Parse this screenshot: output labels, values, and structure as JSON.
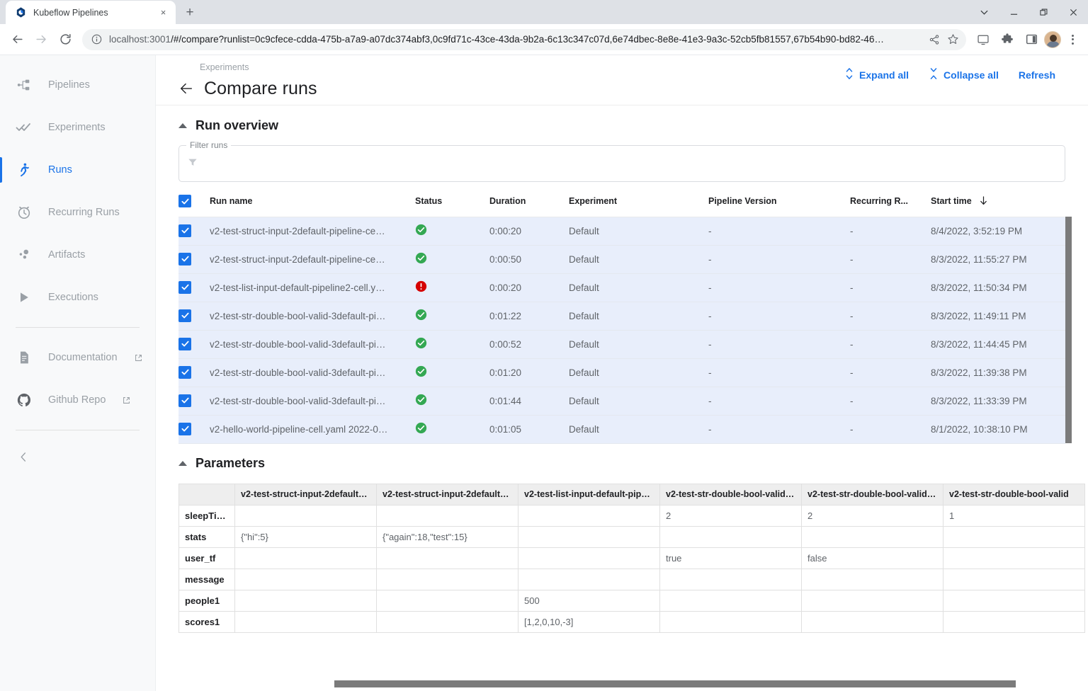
{
  "browser": {
    "tab": {
      "title": "Kubeflow Pipelines",
      "favicon": "kubeflow-logo-icon",
      "close": "×"
    },
    "new_tab_label": "+",
    "window_controls": {
      "tab_search": "tab-search-icon",
      "minimize": "minimize-icon",
      "maximize": "maximize-icon",
      "close": "close-icon"
    },
    "nav": {
      "back": "back-icon",
      "forward": "forward-icon",
      "reload": "reload-icon"
    },
    "omnibox": {
      "site_info": "info-icon",
      "scheme": "localhost:3001",
      "url_rest": "/#/compare?runlist=0c9cfece-cdda-475b-a7a9-a07dc374abf3,0c9fd71c-43ce-43da-9b2a-6c13c347c07d,6e74dbec-8e8e-41e3-9a3c-52cb5fb81557,67b54b90-bd82-46…",
      "share": "share-icon",
      "bookmark": "star-icon"
    },
    "actions": {
      "cast": "cast-icon",
      "extensions": "puzzle-icon",
      "side_panel": "side-panel-icon",
      "profile": "avatar",
      "menu": "kebab-menu-icon"
    }
  },
  "sidebar": {
    "items": [
      {
        "label": "Pipelines",
        "icon": "pipelines-icon",
        "active": false,
        "external": false
      },
      {
        "label": "Experiments",
        "icon": "experiments-icon",
        "active": false,
        "external": false
      },
      {
        "label": "Runs",
        "icon": "runs-icon",
        "active": true,
        "external": false
      },
      {
        "label": "Recurring Runs",
        "icon": "clock-icon",
        "active": false,
        "external": false
      },
      {
        "label": "Artifacts",
        "icon": "artifacts-icon",
        "active": false,
        "external": false
      },
      {
        "label": "Executions",
        "icon": "play-icon",
        "active": false,
        "external": false
      }
    ],
    "links": [
      {
        "label": "Documentation",
        "icon": "document-icon",
        "external": true
      },
      {
        "label": "Github Repo",
        "icon": "github-icon",
        "external": true
      }
    ],
    "collapse": "chevron-left-icon",
    "accent": "#1a73e8"
  },
  "header": {
    "breadcrumb": "Experiments",
    "title": "Compare runs",
    "back": "back-arrow-icon",
    "actions": [
      {
        "label": "Expand all",
        "icon": "expand-all-icon"
      },
      {
        "label": "Collapse all",
        "icon": "collapse-all-icon"
      },
      {
        "label": "Refresh",
        "icon": ""
      }
    ]
  },
  "run_overview": {
    "section_title": "Run overview",
    "filter": {
      "legend": "Filter runs",
      "value": "",
      "placeholder": "",
      "icon": "filter-icon"
    },
    "columns": [
      "Run name",
      "Status",
      "Duration",
      "Experiment",
      "Pipeline Version",
      "Recurring R...",
      "Start time"
    ],
    "sort_column": "Start time",
    "sort_direction": "desc",
    "select_all_checked": true,
    "rows": [
      {
        "checked": true,
        "name": "v2-test-struct-input-2default-pipeline-ce…",
        "status": "succeeded",
        "duration": "0:00:20",
        "experiment": "Default",
        "pipeline_version": "-",
        "recurring_run": "-",
        "start_time": "8/4/2022, 3:52:19 PM"
      },
      {
        "checked": true,
        "name": "v2-test-struct-input-2default-pipeline-ce…",
        "status": "succeeded",
        "duration": "0:00:50",
        "experiment": "Default",
        "pipeline_version": "-",
        "recurring_run": "-",
        "start_time": "8/3/2022, 11:55:27 PM"
      },
      {
        "checked": true,
        "name": "v2-test-list-input-default-pipeline2-cell.y…",
        "status": "failed",
        "duration": "0:00:20",
        "experiment": "Default",
        "pipeline_version": "-",
        "recurring_run": "-",
        "start_time": "8/3/2022, 11:50:34 PM"
      },
      {
        "checked": true,
        "name": "v2-test-str-double-bool-valid-3default-pi…",
        "status": "succeeded",
        "duration": "0:01:22",
        "experiment": "Default",
        "pipeline_version": "-",
        "recurring_run": "-",
        "start_time": "8/3/2022, 11:49:11 PM"
      },
      {
        "checked": true,
        "name": "v2-test-str-double-bool-valid-3default-pi…",
        "status": "succeeded",
        "duration": "0:00:52",
        "experiment": "Default",
        "pipeline_version": "-",
        "recurring_run": "-",
        "start_time": "8/3/2022, 11:44:45 PM"
      },
      {
        "checked": true,
        "name": "v2-test-str-double-bool-valid-3default-pi…",
        "status": "succeeded",
        "duration": "0:01:20",
        "experiment": "Default",
        "pipeline_version": "-",
        "recurring_run": "-",
        "start_time": "8/3/2022, 11:39:38 PM"
      },
      {
        "checked": true,
        "name": "v2-test-str-double-bool-valid-3default-pi…",
        "status": "succeeded",
        "duration": "0:01:44",
        "experiment": "Default",
        "pipeline_version": "-",
        "recurring_run": "-",
        "start_time": "8/3/2022, 11:33:39 PM"
      },
      {
        "checked": true,
        "name": "v2-hello-world-pipeline-cell.yaml 2022-0…",
        "status": "succeeded",
        "duration": "0:01:05",
        "experiment": "Default",
        "pipeline_version": "-",
        "recurring_run": "-",
        "start_time": "8/1/2022, 10:38:10 PM"
      }
    ],
    "status_colors": {
      "succeeded": "#34a853",
      "failed": "#d50000"
    }
  },
  "parameters": {
    "section_title": "Parameters",
    "corner_label": "",
    "columns": [
      "v2-test-struct-input-2default…",
      "v2-test-struct-input-2default…",
      "v2-test-list-input-default-pip…",
      "v2-test-str-double-bool-valid…",
      "v2-test-str-double-bool-valid…",
      "v2-test-str-double-bool-valid"
    ],
    "rows": [
      {
        "label": "sleepTime",
        "values": [
          "",
          "",
          "",
          "2",
          "2",
          "1"
        ]
      },
      {
        "label": "stats",
        "values": [
          "{\"hi\":5}",
          "{\"again\":18,\"test\":15}",
          "",
          "",
          "",
          ""
        ]
      },
      {
        "label": "user_tf",
        "values": [
          "",
          "",
          "",
          "true",
          "false",
          ""
        ]
      },
      {
        "label": "message",
        "values": [
          "",
          "",
          "",
          "",
          "",
          ""
        ]
      },
      {
        "label": "people1",
        "values": [
          "",
          "",
          "500",
          "",
          "",
          ""
        ]
      },
      {
        "label": "scores1",
        "values": [
          "",
          "",
          "[1,2,0,10,-3]",
          "",
          "",
          ""
        ]
      }
    ]
  }
}
